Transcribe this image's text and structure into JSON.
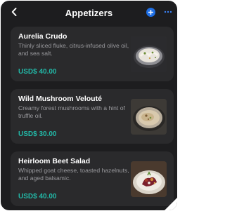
{
  "header": {
    "title": "Appetizers",
    "back_icon": "chevron-left-icon",
    "add_icon": "plus-circle-icon",
    "more_icon": "more-horizontal-icon"
  },
  "colors": {
    "background": "#1d1d1f",
    "card": "#2a2a2c",
    "price": "#22b8a7",
    "accent": "#1f6fe5"
  },
  "items": [
    {
      "name": "Aurelia Crudo",
      "description": "Thinly sliced fluke, citrus-infused olive oil, and sea salt.",
      "price": "USD$ 40.00",
      "image_icon": "crudo-dish-image"
    },
    {
      "name": "Wild Mushroom Velouté",
      "description": "Creamy forest mushrooms with a hint of truffle oil.",
      "price": "USD$ 30.00",
      "image_icon": "soup-bowl-image"
    },
    {
      "name": "Heirloom Beet Salad",
      "description": "Whipped goat cheese, toasted hazelnuts, and aged balsamic.",
      "price": "USD$ 40.00",
      "image_icon": "beet-salad-image"
    }
  ]
}
